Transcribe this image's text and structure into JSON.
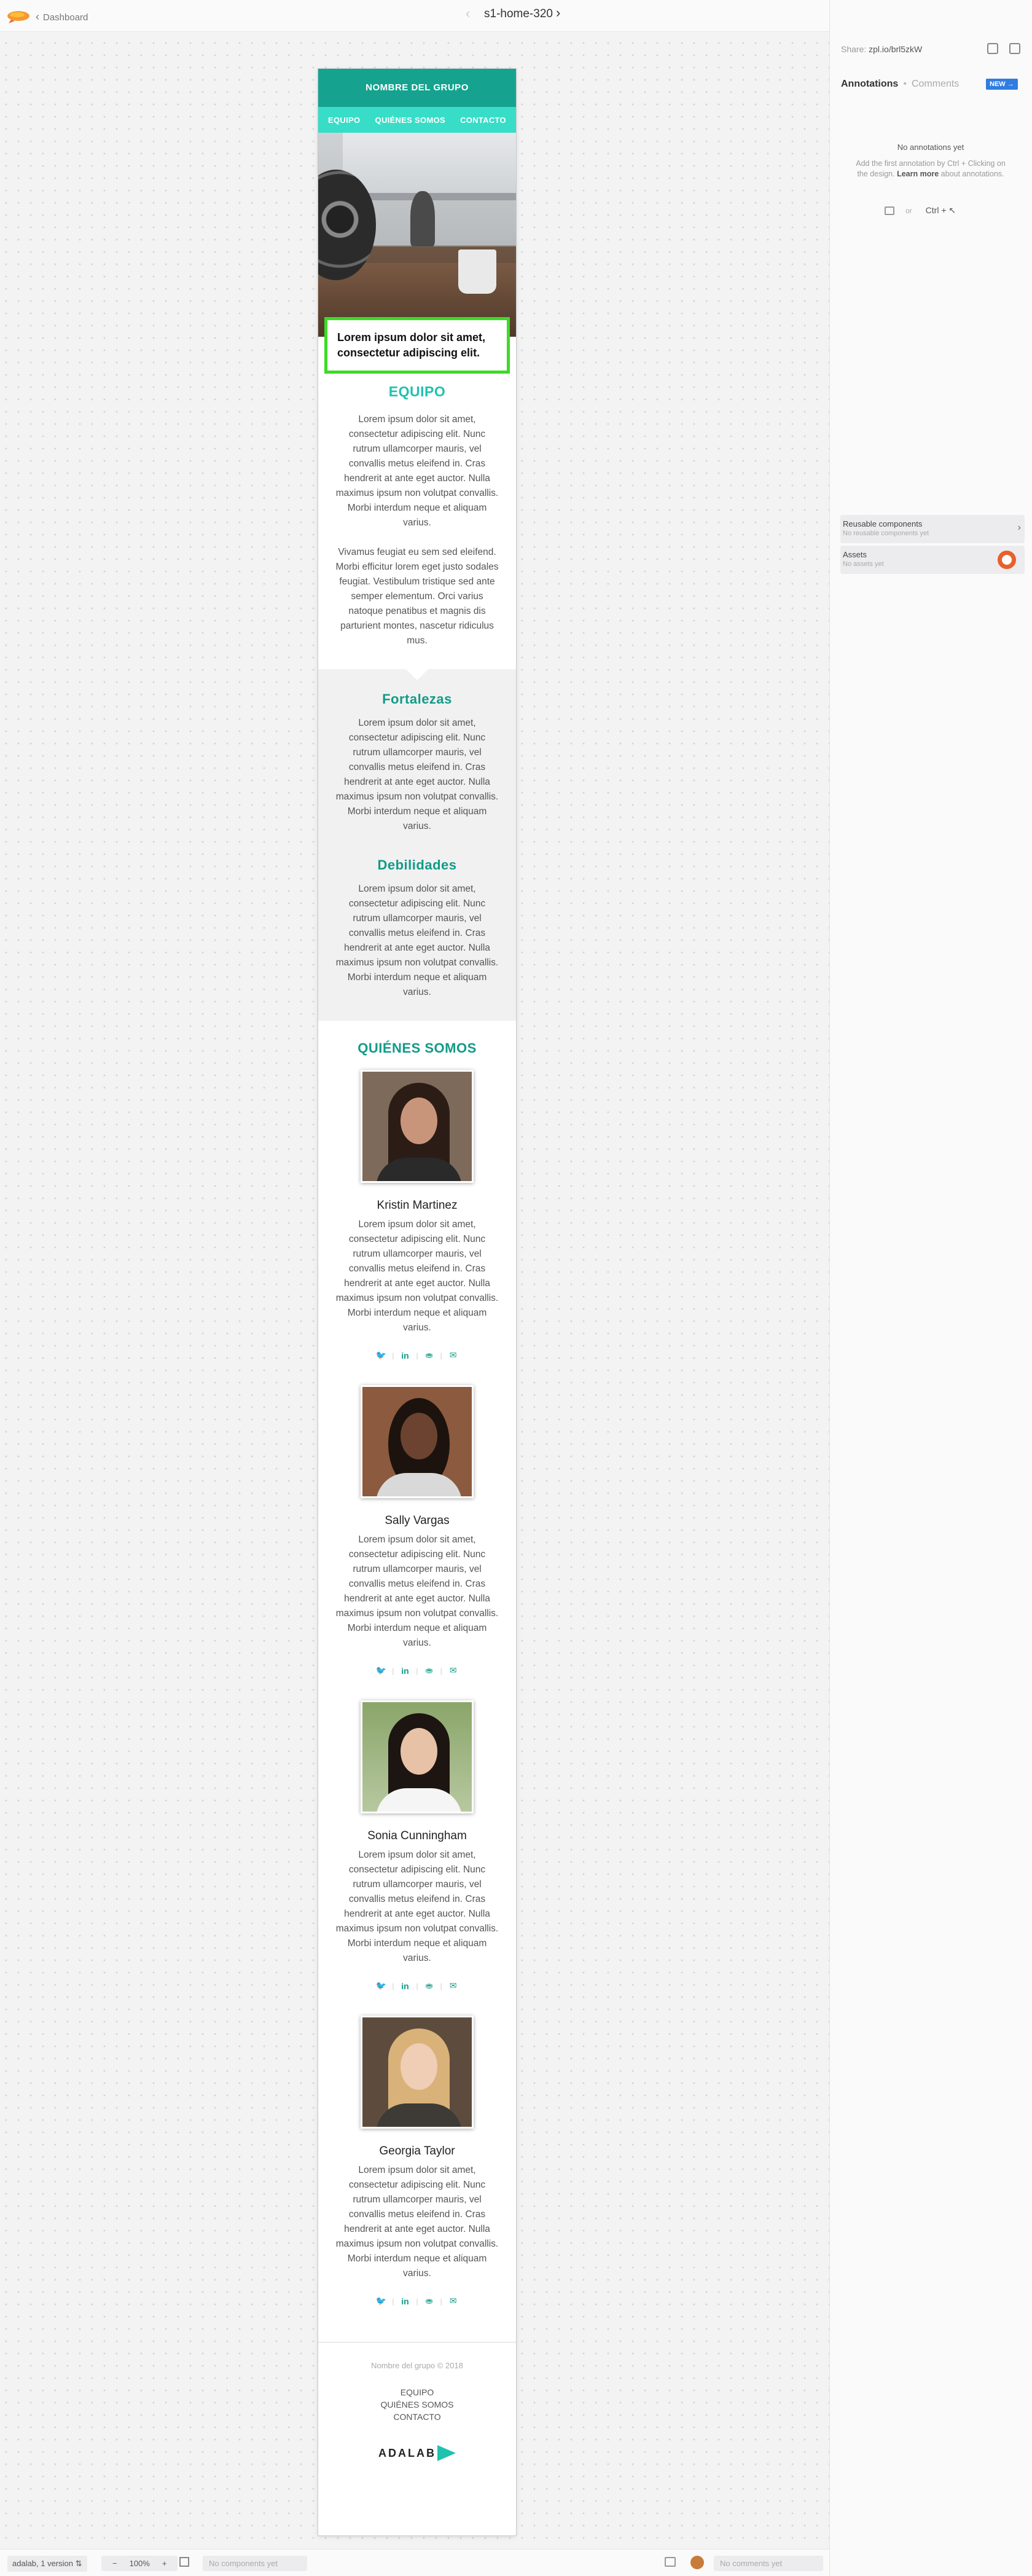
{
  "topbar": {
    "back_label": "Dashboard",
    "screen_title": "s1-home-320",
    "prev_arrow": "‹",
    "next_arrow": "›"
  },
  "sidebar": {
    "share_label": "Share:",
    "share_url": "zpl.io/brl5zkW",
    "tab_annotations": "Annotations",
    "tab_dot": "•",
    "tab_comments": "Comments",
    "new_badge": "NEW →",
    "no_annotations": "No annotations yet",
    "help_pre": "Add the first annotation by Ctrl + Clicking on the design.",
    "help_link": "Learn more",
    "help_post": "about annotations.",
    "or_label": "or",
    "ctrl_label": "Ctrl",
    "plus_label": "+ ↖",
    "reusable_title": "Reusable components",
    "reusable_sub": "No reusable components yet",
    "assets_title": "Assets",
    "assets_sub": "No assets yet",
    "arrow": "›"
  },
  "bottombar": {
    "project": "adalab, 1 version",
    "zoom_minus": "−",
    "zoom_value": "100%",
    "zoom_plus": "+",
    "components_placeholder": "No components yet",
    "comments_placeholder": "No comments yet"
  },
  "screen": {
    "header_title": "NOMBRE DEL GRUPO",
    "nav": [
      "EQUIPO",
      "QUIÉNES SOMOS",
      "CONTACTO"
    ],
    "hero_text": "Lorem ipsum dolor sit amet, consectetur adipiscing elit.",
    "equipo_title": "EQUIPO",
    "equipo_p1": "Lorem ipsum dolor sit amet, consectetur adipiscing elit. Nunc rutrum ullamcorper mauris, vel convallis metus eleifend in. Cras hendrerit at ante eget auctor. Nulla maximus ipsum non volutpat convallis. Morbi interdum neque et aliquam varius.",
    "equipo_p2": "Vivamus feugiat eu sem sed eleifend. Morbi efficitur lorem eget justo sodales feugiat. Vestibulum tristique sed ante semper elementum. Orci varius natoque penatibus et magnis dis parturient montes, nascetur ridiculus mus.",
    "fortalezas_title": "Fortalezas",
    "fortalezas_p": "Lorem ipsum dolor sit amet, consectetur adipiscing elit. Nunc rutrum ullamcorper mauris, vel convallis metus eleifend in. Cras hendrerit at ante eget auctor. Nulla maximus ipsum non volutpat convallis. Morbi interdum neque et aliquam varius.",
    "debilidades_title": "Debilidades",
    "debilidades_p": "Lorem ipsum dolor sit amet, consectetur adipiscing elit. Nunc rutrum ullamcorper mauris, vel convallis metus eleifend in. Cras hendrerit at ante eget auctor. Nulla maximus ipsum non volutpat convallis. Morbi interdum neque et aliquam varius.",
    "quienes_title": "QUIÉNES SOMOS",
    "members": [
      {
        "name": "Kristin Martinez",
        "bio": "Lorem ipsum dolor sit amet, consectetur adipiscing elit. Nunc rutrum ullamcorper mauris, vel convallis metus eleifend in. Cras hendrerit at ante eget auctor. Nulla maximus ipsum non volutpat convallis. Morbi interdum neque et aliquam varius."
      },
      {
        "name": "Sally Vargas",
        "bio": "Lorem ipsum dolor sit amet, consectetur adipiscing elit. Nunc rutrum ullamcorper mauris, vel convallis metus eleifend in. Cras hendrerit at ante eget auctor. Nulla maximus ipsum non volutpat convallis. Morbi interdum neque et aliquam varius."
      },
      {
        "name": "Sonia Cunningham",
        "bio": "Lorem ipsum dolor sit amet, consectetur adipiscing elit. Nunc rutrum ullamcorper mauris, vel convallis metus eleifend in. Cras hendrerit at ante eget auctor. Nulla maximus ipsum non volutpat convallis. Morbi interdum neque et aliquam varius."
      },
      {
        "name": "Georgia Taylor",
        "bio": "Lorem ipsum dolor sit amet, consectetur adipiscing elit. Nunc rutrum ullamcorper mauris, vel convallis metus eleifend in. Cras hendrerit at ante eget auctor. Nulla maximus ipsum non volutpat convallis. Morbi interdum neque et aliquam varius."
      }
    ],
    "social_icons": [
      "twitter-icon",
      "linkedin-icon",
      "github-icon",
      "mail-icon"
    ],
    "social_glyphs": {
      "twitter": "🐦",
      "linkedin": "in",
      "github": "⛂",
      "mail": "✉"
    },
    "footer_copy": "Nombre del grupo © 2018",
    "footer_links": [
      "EQUIPO",
      "QUIÉNES SOMOS",
      "CONTACTO"
    ],
    "footer_logo": "ADALAB"
  },
  "colors": {
    "header": "#15a38f",
    "nav": "#37ddc7",
    "accent": "#1fc2ae",
    "highlight_border": "#3ddb25",
    "new_badge": "#2f7de1"
  }
}
